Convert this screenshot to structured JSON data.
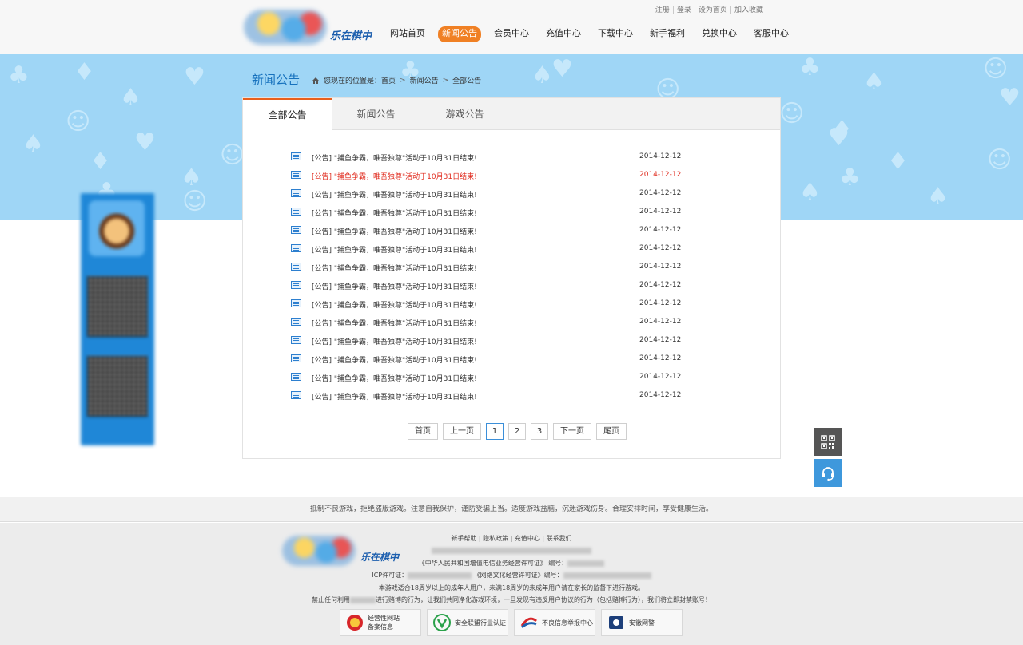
{
  "header": {
    "logo_text": "乐在棋中",
    "top_links": [
      "注册",
      "登录",
      "设为首页",
      "加入收藏"
    ],
    "nav": [
      {
        "label": "网站首页",
        "active": false
      },
      {
        "label": "新闻公告",
        "active": true
      },
      {
        "label": "会员中心",
        "active": false
      },
      {
        "label": "充值中心",
        "active": false
      },
      {
        "label": "下载中心",
        "active": false
      },
      {
        "label": "新手福利",
        "active": false
      },
      {
        "label": "兑换中心",
        "active": false
      },
      {
        "label": "客服中心",
        "active": false
      }
    ]
  },
  "page": {
    "title": "新闻公告",
    "breadcrumb": {
      "prefix": "您现在的位置是：",
      "items": [
        "首页",
        "新闻公告",
        "全部公告"
      ]
    }
  },
  "tabs": [
    {
      "label": "全部公告",
      "active": true
    },
    {
      "label": "新闻公告",
      "active": false
    },
    {
      "label": "游戏公告",
      "active": false
    }
  ],
  "news": [
    {
      "title": "[公告] \"捕鱼争霸，唯吾独尊\"活动于10月31日结束!",
      "date": "2014-12-12",
      "hot": false
    },
    {
      "title": "[公告] \"捕鱼争霸，唯吾独尊\"活动于10月31日结束!",
      "date": "2014-12-12",
      "hot": true
    },
    {
      "title": "[公告] \"捕鱼争霸，唯吾独尊\"活动于10月31日结束!",
      "date": "2014-12-12",
      "hot": false
    },
    {
      "title": "[公告] \"捕鱼争霸，唯吾独尊\"活动于10月31日结束!",
      "date": "2014-12-12",
      "hot": false
    },
    {
      "title": "[公告] \"捕鱼争霸，唯吾独尊\"活动于10月31日结束!",
      "date": "2014-12-12",
      "hot": false
    },
    {
      "title": "[公告] \"捕鱼争霸，唯吾独尊\"活动于10月31日结束!",
      "date": "2014-12-12",
      "hot": false
    },
    {
      "title": "[公告] \"捕鱼争霸，唯吾独尊\"活动于10月31日结束!",
      "date": "2014-12-12",
      "hot": false
    },
    {
      "title": "[公告] \"捕鱼争霸，唯吾独尊\"活动于10月31日结束!",
      "date": "2014-12-12",
      "hot": false
    },
    {
      "title": "[公告] \"捕鱼争霸，唯吾独尊\"活动于10月31日结束!",
      "date": "2014-12-12",
      "hot": false
    },
    {
      "title": "[公告] \"捕鱼争霸，唯吾独尊\"活动于10月31日结束!",
      "date": "2014-12-12",
      "hot": false
    },
    {
      "title": "[公告] \"捕鱼争霸，唯吾独尊\"活动于10月31日结束!",
      "date": "2014-12-12",
      "hot": false
    },
    {
      "title": "[公告] \"捕鱼争霸，唯吾独尊\"活动于10月31日结束!",
      "date": "2014-12-12",
      "hot": false
    },
    {
      "title": "[公告] \"捕鱼争霸，唯吾独尊\"活动于10月31日结束!",
      "date": "2014-12-12",
      "hot": false
    },
    {
      "title": "[公告] \"捕鱼争霸，唯吾独尊\"活动于10月31日结束!",
      "date": "2014-12-12",
      "hot": false
    }
  ],
  "pager": {
    "first": "首页",
    "prev": "上一页",
    "pages": [
      "1",
      "2",
      "3"
    ],
    "current": "1",
    "next": "下一页",
    "last": "尾页"
  },
  "footer": {
    "notice": "抵制不良游戏，拒绝盗版游戏。注意自我保护，谨防受骗上当。适度游戏益脑，沉迷游戏伤身。合理安排时间，享受健康生活。",
    "links": [
      "新手帮助",
      "隐私政策",
      "充值中心",
      "联系我们"
    ],
    "license_line": "《中华人民共和国增值电信业务经营许可证》 编号：",
    "icp_label": "ICP许可证：",
    "culture_license": "《网络文化经营许可证》编号：",
    "age_notice": "本游戏适合18周岁以上的成年人用户，未满18周岁的未成年用户请在家长的监督下进行游戏。",
    "ban_prefix": "禁止任何利用",
    "ban_suffix": "进行赌博的行为，让我们共同净化游戏环境，一旦发现有违反用户协议的行为（包括赌博行为），我们将立即封禁账号！",
    "badges": [
      {
        "line1": "经营性网站",
        "line2": "备案信息",
        "icon": "badge-shield-icon"
      },
      {
        "line1": "安全联盟行业认证",
        "line2": "",
        "icon": "verified-v-icon"
      },
      {
        "line1": "不良信息举报中心",
        "line2": "",
        "icon": "report-center-icon"
      },
      {
        "line1": "安徽网警",
        "line2": "",
        "icon": "police-icon"
      }
    ]
  },
  "floating": {
    "qr_icon": "qr-code-icon",
    "cs_icon": "headset-icon"
  },
  "colors": {
    "accent_orange": "#f08024",
    "link_blue": "#1671bd",
    "hot_red": "#e02b1e",
    "banner_blue": "#9fd6f6"
  }
}
